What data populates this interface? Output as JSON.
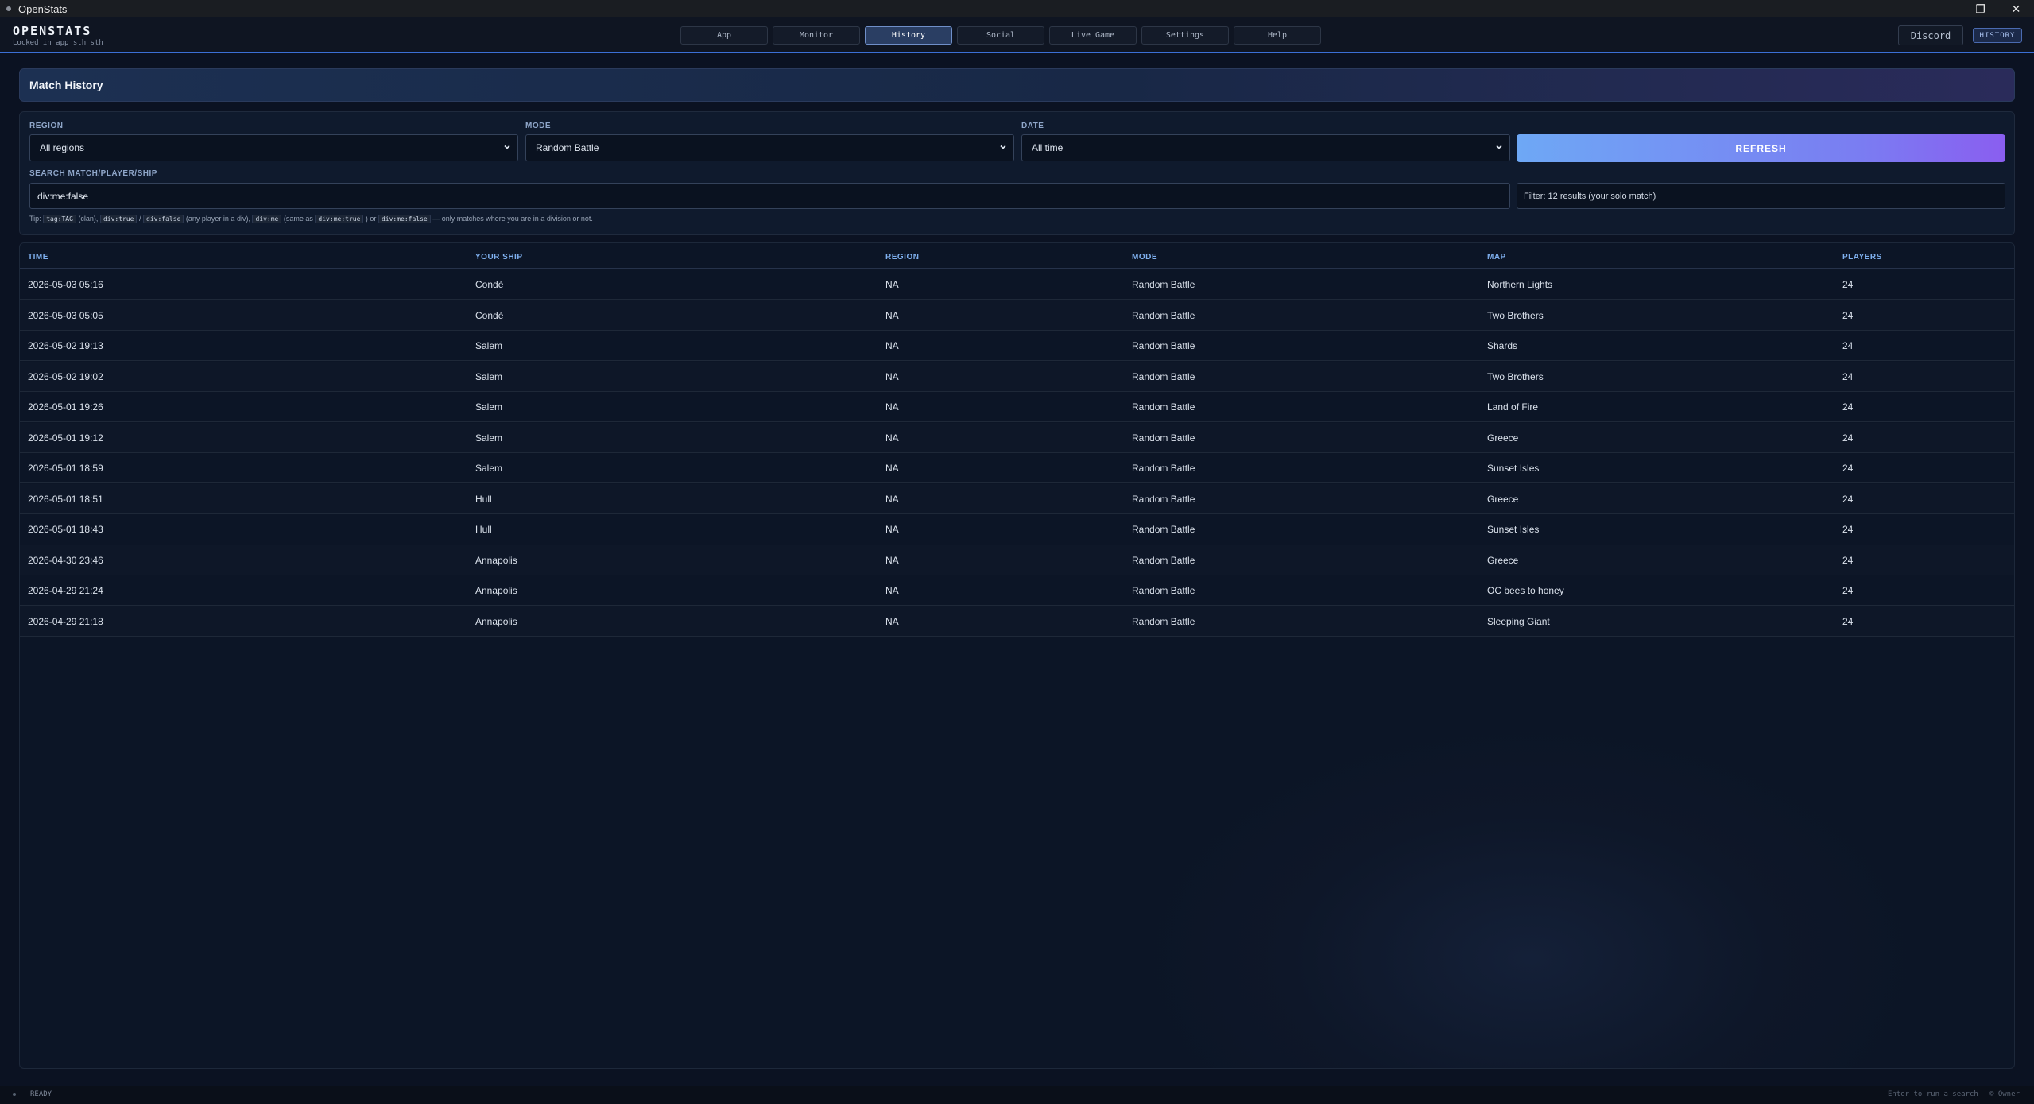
{
  "window": {
    "title": "OpenStats",
    "controls": [
      "—",
      "❐",
      "✕"
    ]
  },
  "header": {
    "brand": "OPENSTATS",
    "subtitle": "Locked in app sth sth",
    "tabs": [
      {
        "label": "App",
        "active": false
      },
      {
        "label": "Monitor",
        "active": false
      },
      {
        "label": "History",
        "active": true
      },
      {
        "label": "Social",
        "active": false
      },
      {
        "label": "Live Game",
        "active": false
      },
      {
        "label": "Settings",
        "active": false
      },
      {
        "label": "Help",
        "active": false
      }
    ],
    "discord_label": "Discord",
    "page_badge": "HISTORY"
  },
  "section": {
    "title": "Match History"
  },
  "filters": {
    "region_label": "REGION",
    "region_value": "All regions",
    "mode_label": "MODE",
    "mode_value": "Random Battle",
    "date_label": "DATE",
    "date_value": "All time",
    "refresh_label": "REFRESH",
    "search_label": "SEARCH MATCH/PLAYER/SHIP",
    "search_value": "div:me:false",
    "filter_status": "Filter: 12 results (your solo match)",
    "tip": {
      "prefix": "Tip:",
      "code1": "tag:TAG",
      "text1": "(clan),",
      "code2": "div:true",
      "text2": "/",
      "code3": "div:false",
      "text3": "(any player in a div),",
      "code4": "div:me",
      "text4": "(same as",
      "code5": "div:me:true",
      "text5": ") or",
      "code6": "div:me:false",
      "text6": "— only matches where you are in a division or not."
    }
  },
  "table": {
    "columns": [
      "TIME",
      "YOUR SHIP",
      "REGION",
      "MODE",
      "MAP",
      "PLAYERS"
    ],
    "rows": [
      [
        "2026-05-03 05:16",
        "Condé",
        "NA",
        "Random Battle",
        "Northern Lights",
        "24"
      ],
      [
        "2026-05-03 05:05",
        "Condé",
        "NA",
        "Random Battle",
        "Two Brothers",
        "24"
      ],
      [
        "2026-05-02 19:13",
        "Salem",
        "NA",
        "Random Battle",
        "Shards",
        "24"
      ],
      [
        "2026-05-02 19:02",
        "Salem",
        "NA",
        "Random Battle",
        "Two Brothers",
        "24"
      ],
      [
        "2026-05-01 19:26",
        "Salem",
        "NA",
        "Random Battle",
        "Land of Fire",
        "24"
      ],
      [
        "2026-05-01 19:12",
        "Salem",
        "NA",
        "Random Battle",
        "Greece",
        "24"
      ],
      [
        "2026-05-01 18:59",
        "Salem",
        "NA",
        "Random Battle",
        "Sunset Isles",
        "24"
      ],
      [
        "2026-05-01 18:51",
        "Hull",
        "NA",
        "Random Battle",
        "Greece",
        "24"
      ],
      [
        "2026-05-01 18:43",
        "Hull",
        "NA",
        "Random Battle",
        "Sunset Isles",
        "24"
      ],
      [
        "2026-04-30 23:46",
        "Annapolis",
        "NA",
        "Random Battle",
        "Greece",
        "24"
      ],
      [
        "2026-04-29 21:24",
        "Annapolis",
        "NA",
        "Random Battle",
        "OC bees to honey",
        "24"
      ],
      [
        "2026-04-29 21:18",
        "Annapolis",
        "NA",
        "Random Battle",
        "Sleeping Giant",
        "24"
      ]
    ]
  },
  "statusbar": {
    "status": "READY",
    "hint": "Enter to run a search",
    "right": "© Owner"
  },
  "colors": {
    "accent": "#3b6fd6",
    "column_header": "#7fb0ef",
    "refresh_gradient_start": "#6ea8f5",
    "refresh_gradient_end": "#8a5ef0"
  }
}
